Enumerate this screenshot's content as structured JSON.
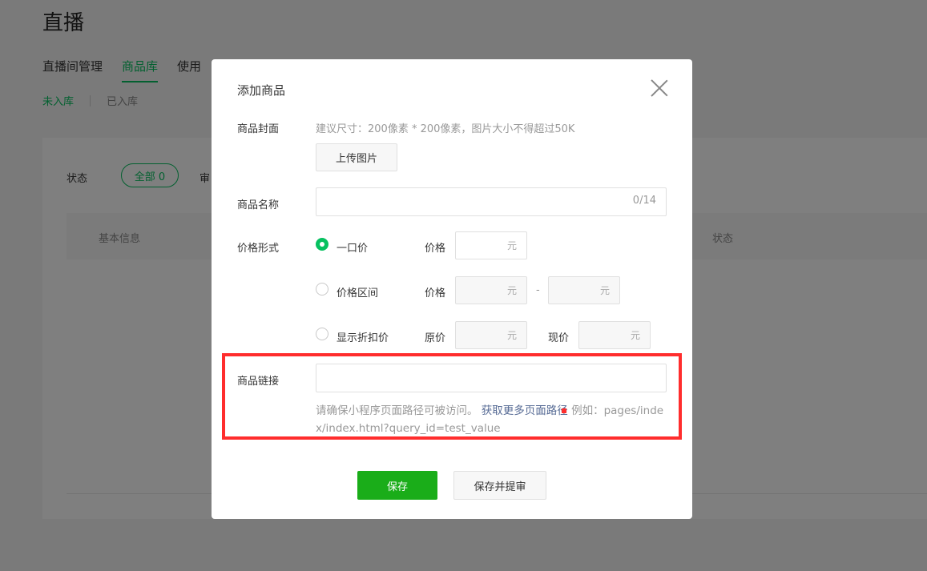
{
  "page": {
    "title": "直播",
    "tabs": [
      {
        "label": "直播间管理",
        "active": false
      },
      {
        "label": "商品库",
        "active": true
      },
      {
        "label": "使用"
      }
    ],
    "subtabs": [
      {
        "label": "未入库",
        "active": true
      },
      {
        "label": "已入库",
        "active": false
      }
    ],
    "filter": {
      "status_label": "状态",
      "all_pill": "全部 0",
      "next_label": "审"
    },
    "table": {
      "col_basic": "基本信息",
      "col_status": "状态"
    }
  },
  "modal": {
    "title": "添加商品",
    "cover": {
      "label": "商品封面",
      "hint": "建议尺寸：200像素 * 200像素，图片大小不得超过50K",
      "upload_label": "上传图片"
    },
    "name": {
      "label": "商品名称",
      "counter": "0/14"
    },
    "price": {
      "label": "价格形式",
      "options": [
        {
          "label": "一口价",
          "checked": true
        },
        {
          "label": "价格区间",
          "checked": false
        },
        {
          "label": "显示折扣价",
          "checked": false
        }
      ],
      "price_label": "价格",
      "dash": "-",
      "original_label": "原价",
      "current_label": "现价",
      "unit": "元"
    },
    "link": {
      "label": "商品链接",
      "hint_prefix": "请确保小程序页面路径可被访问。",
      "hint_link": "获取更多页面路径",
      "hint_suffix": "例如：pages/index/index.html?query_id=test_value"
    },
    "actions": {
      "save": "保存",
      "save_submit": "保存并提审"
    }
  },
  "colors": {
    "accent": "#07c160",
    "primary_button": "#1aad19",
    "highlight": "#ff2d2d",
    "link": "#576b95"
  }
}
